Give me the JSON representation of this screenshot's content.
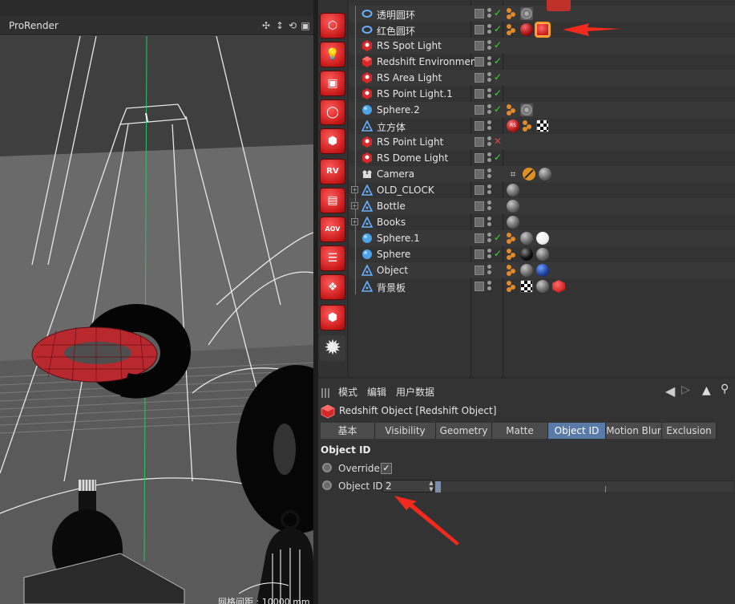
{
  "viewport": {
    "title": "ProRender",
    "grid_label": "网格间距 : 10000 mm"
  },
  "toolbar": {
    "icons": [
      "redshift-icon",
      "rs-light-icon",
      "rs-camera-icon",
      "rs-dome-icon",
      "rs-object-icon",
      "rs-render-view-icon",
      "rs-texture-icon",
      "rs-aov-icon",
      "rs-list-icon",
      "rs-proxy-icon",
      "rs-redshift-icon",
      "rs-settings-icon"
    ]
  },
  "objects": [
    {
      "name": "透明圆环",
      "icon": "torus-icon",
      "check": "ok",
      "tags": [
        "phong",
        "noise"
      ]
    },
    {
      "name": "红色圆环",
      "icon": "torus-icon",
      "check": "ok",
      "tags": [
        "phong",
        "red",
        "cube-hl"
      ]
    },
    {
      "name": "RS Spot Light",
      "icon": "rs-light-icon",
      "check": "ok",
      "tags": []
    },
    {
      "name": "Redshift Environment",
      "icon": "rs-env-icon",
      "check": "ok",
      "tags": []
    },
    {
      "name": "RS Area Light",
      "icon": "rs-light-icon",
      "check": "ok",
      "tags": []
    },
    {
      "name": "RS Point Light.1",
      "icon": "rs-light-icon",
      "check": "ok",
      "tags": []
    },
    {
      "name": "Sphere.2",
      "icon": "sphere-icon",
      "check": "ok",
      "tags": [
        "phong",
        "noise"
      ]
    },
    {
      "name": "立方体",
      "icon": "null-icon",
      "check": "none",
      "tags": [
        "rsred",
        "phong",
        "checker"
      ]
    },
    {
      "name": "RS Point Light",
      "icon": "rs-light-icon",
      "check": "off",
      "tags": []
    },
    {
      "name": "RS Dome Light",
      "icon": "rs-light-icon",
      "check": "ok",
      "tags": []
    },
    {
      "name": "Camera",
      "icon": "camera-icon",
      "check": "none",
      "tags": [
        "cam",
        "nope",
        "sphere"
      ]
    },
    {
      "name": "OLD_CLOCK",
      "icon": "null-icon",
      "check": "none",
      "expand": true,
      "tags": [
        "sphere"
      ]
    },
    {
      "name": "Bottle",
      "icon": "null-icon",
      "check": "none",
      "expand": true,
      "tags": [
        "sphere"
      ]
    },
    {
      "name": "Books",
      "icon": "null-icon",
      "check": "none",
      "expand": true,
      "tags": [
        "sphere"
      ]
    },
    {
      "name": "Sphere.1",
      "icon": "sphere-icon",
      "check": "ok",
      "tags": [
        "phong",
        "sphere",
        "white"
      ]
    },
    {
      "name": "Sphere",
      "icon": "sphere-icon",
      "check": "ok",
      "tags": [
        "phong",
        "black",
        "sphere"
      ]
    },
    {
      "name": "Object",
      "icon": "null-icon",
      "check": "none",
      "tags": [
        "phong",
        "sphere",
        "blue"
      ]
    },
    {
      "name": "背景板",
      "icon": "null-icon",
      "check": "none",
      "tags": [
        "phong",
        "checker",
        "sphere",
        "cube"
      ]
    }
  ],
  "attr": {
    "menu": [
      "模式",
      "编辑",
      "用户数据"
    ],
    "title": "Redshift Object [Redshift Object]",
    "tabs": [
      "基本",
      "Visibility",
      "Geometry",
      "Matte",
      "Object ID",
      "Motion Blur",
      "Exclusion"
    ],
    "active_tab": "Object ID",
    "section": "Object ID",
    "override_label": "Override",
    "override_checked": true,
    "objid_label": "Object ID",
    "objid_value": "2",
    "objid_fill": 0.02
  },
  "colors": {
    "accent_red": "#d62a2a",
    "active_tab": "#5a7ba8",
    "annotation_arrow": "#f02a1e"
  }
}
